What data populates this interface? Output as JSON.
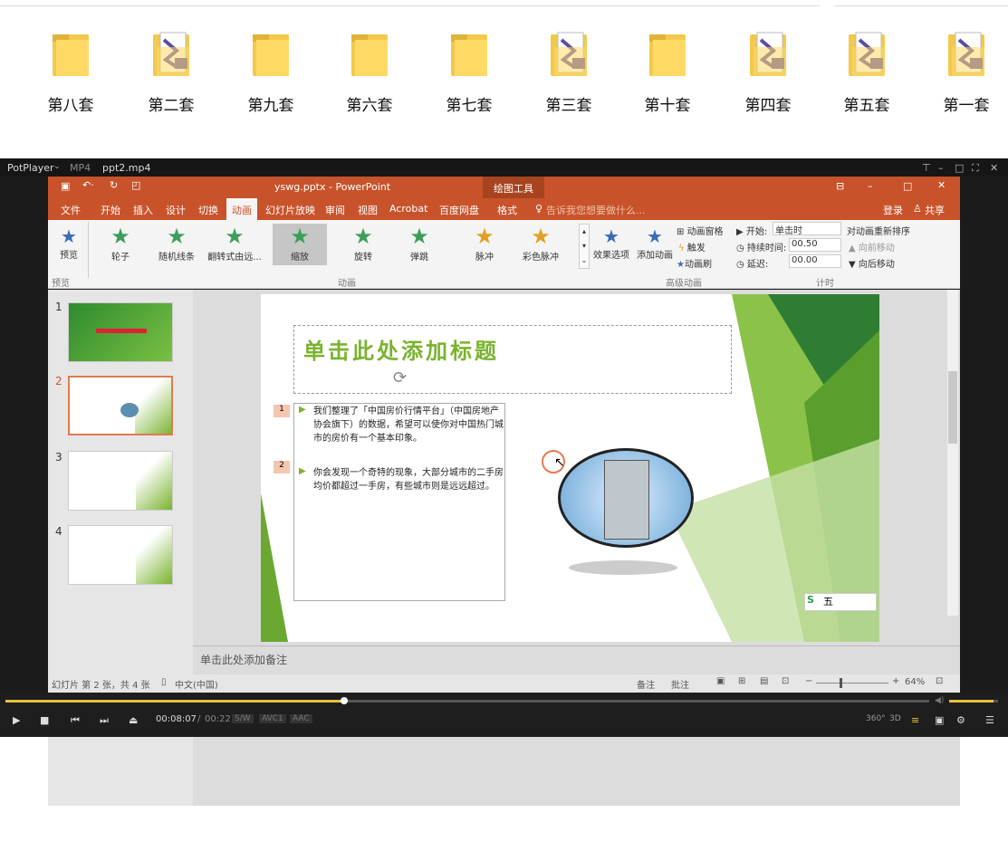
{
  "folders": [
    {
      "name": "第八套",
      "type": "folder"
    },
    {
      "name": "第二套",
      "type": "media"
    },
    {
      "name": "第九套",
      "type": "folder"
    },
    {
      "name": "第六套",
      "type": "folder"
    },
    {
      "name": "第七套",
      "type": "folder"
    },
    {
      "name": "第三套",
      "type": "media"
    },
    {
      "name": "第十套",
      "type": "folder"
    },
    {
      "name": "第四套",
      "type": "media"
    },
    {
      "name": "第五套",
      "type": "media"
    },
    {
      "name": "第一套",
      "type": "media"
    }
  ],
  "player": {
    "app_name": "PotPlayer",
    "format": "MP4",
    "file": "ppt2.mp4",
    "time_current": "00:08:07",
    "time_separator": "/",
    "time_total": "00:22:06",
    "badges": [
      "S/W",
      "AVC1",
      "AAC"
    ],
    "progress": 0.367,
    "volume": 0.9,
    "right_icons": [
      "360°",
      "3D"
    ],
    "accent": "#e8c13a"
  },
  "ppt": {
    "title": "yswg.pptx - PowerPoint",
    "tool_tab": "绘图工具",
    "menu": [
      "文件",
      "开始",
      "插入",
      "设计",
      "切换",
      "动画",
      "幻灯片放映",
      "审阅",
      "视图",
      "Acrobat",
      "百度网盘",
      "格式"
    ],
    "active_menu": "动画",
    "tell_me": "告诉我您想要做什么...",
    "login": "登录",
    "share": "共享",
    "preview_label": "预览",
    "effects": [
      "轮子",
      "随机线条",
      "翻转式由远...",
      "缩放",
      "旋转",
      "弹跳",
      "脉冲",
      "彩色脉冲"
    ],
    "selected_effect": "缩放",
    "effect_options": "效果选项",
    "add_animation": "添加动画",
    "anim_pane": "动画窗格",
    "trigger": "触发",
    "anim_painter": "动画刷",
    "start_label": "开始:",
    "start_value": "单击时",
    "duration_label": "持续时间:",
    "duration_value": "00.50",
    "delay_label": "延迟:",
    "delay_value": "00.00",
    "reorder": "对动画重新排序",
    "move_earlier": "向前移动",
    "move_later": "向后移动",
    "group_preview": "预览",
    "group_animation": "动画",
    "group_advanced": "高级动画",
    "group_timing": "计时",
    "slide_numbers": [
      "1",
      "2",
      "3",
      "4"
    ],
    "slide_title": "单击此处添加标题",
    "bullet_tags": [
      "1",
      "2"
    ],
    "bullets": [
      "我们整理了「中国房价行情平台」（中国房地产协会旗下）的数据，希望可以使你对中国热门城市的房价有一个基本印象。",
      "你会发现一个奇特的现象，大部分城市的二手房均价都超过一手房，有些城市则是远远超过。"
    ],
    "notes_placeholder": "单击此处添加备注",
    "status_slide": "幻灯片 第 2 张，共 4 张",
    "status_lang": "中文(中国)",
    "notes_btn": "备注",
    "comments_btn": "批注",
    "zoom": "64%",
    "ime_label": "五",
    "colors": {
      "accent": "#c8532b",
      "green": "#7ab32e"
    }
  }
}
